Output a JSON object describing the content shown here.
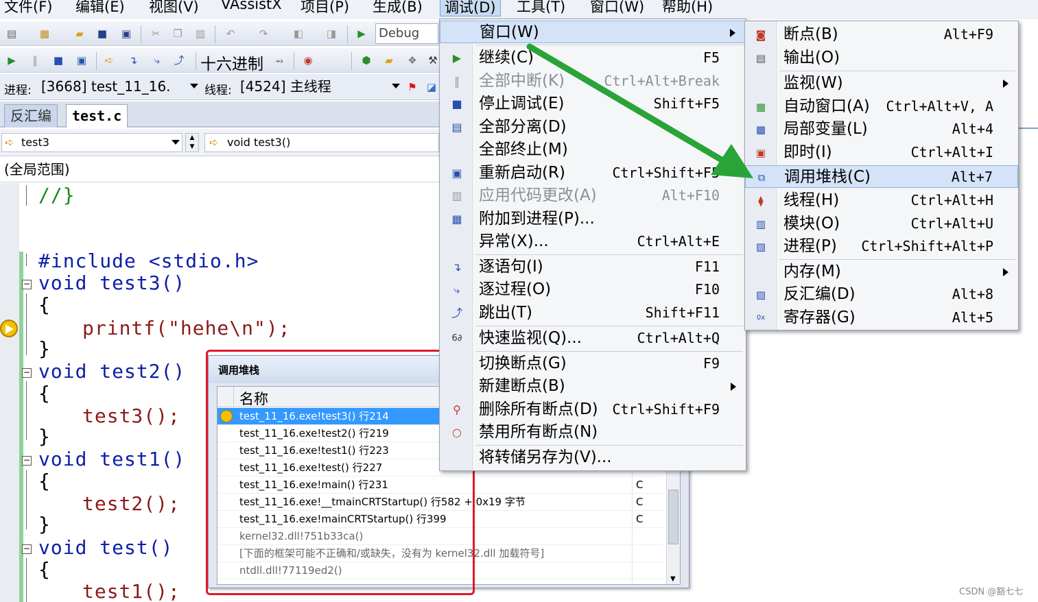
{
  "menubar": {
    "items": [
      "文件(F)",
      "编辑(E)",
      "视图(V)",
      "VAssistX",
      "项目(P)",
      "生成(B)",
      "调试(D)",
      "工具(T)",
      "窗口(W)",
      "帮助(H)"
    ]
  },
  "toolbar": {
    "config": "Debug",
    "hex_label": "十六进制"
  },
  "process_bar": {
    "process_label": "进程:",
    "process_value": "[3668] test_11_16.",
    "thread_label": "线程:",
    "thread_value": "[4524] 主线程"
  },
  "tabs": [
    "反汇编",
    "test.c"
  ],
  "nav": {
    "left": "test3",
    "right": "void test3()"
  },
  "scope": "(全局范围)",
  "code": [
    "//}",
    "#include <stdio.h>",
    "void test3()",
    "{",
    "printf(\"hehe\\n\");",
    "}",
    "void test2()",
    "{",
    "test3();",
    "}",
    "void test1()",
    "{",
    "test2();",
    "}",
    "void test()",
    "{",
    "test1();"
  ],
  "callstack": {
    "title": "调用堆栈",
    "column_name": "名称",
    "rows": [
      {
        "name": "test_11_16.exe!test3() 行214",
        "lang": ""
      },
      {
        "name": "test_11_16.exe!test2() 行219",
        "lang": ""
      },
      {
        "name": "test_11_16.exe!test1() 行223",
        "lang": ""
      },
      {
        "name": "test_11_16.exe!test() 行227",
        "lang": ""
      },
      {
        "name": "test_11_16.exe!main() 行231",
        "lang": "C"
      },
      {
        "name": "test_11_16.exe!__tmainCRTStartup() 行582 + 0x19 字节",
        "lang": "C"
      },
      {
        "name": "test_11_16.exe!mainCRTStartup() 行399",
        "lang": "C"
      },
      {
        "name": "kernel32.dll!751b33ca()",
        "lang": ""
      },
      {
        "name": "[下面的框架可能不正确和/或缺失，没有为 kernel32.dll 加载符号]",
        "lang": ""
      },
      {
        "name": "ntdll.dll!77119ed2()",
        "lang": ""
      }
    ]
  },
  "debug_menu": {
    "items": [
      {
        "label": "窗口(W)",
        "shortcut": "",
        "submenu": true,
        "disabled": false
      },
      {
        "label": "继续(C)",
        "shortcut": "F5",
        "disabled": false
      },
      {
        "label": "全部中断(K)",
        "shortcut": "Ctrl+Alt+Break",
        "disabled": true
      },
      {
        "label": "停止调试(E)",
        "shortcut": "Shift+F5",
        "disabled": false
      },
      {
        "label": "全部分离(D)",
        "shortcut": "",
        "disabled": false
      },
      {
        "label": "全部终止(M)",
        "shortcut": "",
        "disabled": false
      },
      {
        "label": "重新启动(R)",
        "shortcut": "Ctrl+Shift+F5",
        "disabled": false
      },
      {
        "label": "应用代码更改(A)",
        "shortcut": "Alt+F10",
        "disabled": true
      },
      {
        "label": "附加到进程(P)...",
        "shortcut": "",
        "disabled": false
      },
      {
        "label": "异常(X)...",
        "shortcut": "Ctrl+Alt+E",
        "disabled": false
      },
      {
        "label": "逐语句(I)",
        "shortcut": "F11",
        "disabled": false
      },
      {
        "label": "逐过程(O)",
        "shortcut": "F10",
        "disabled": false
      },
      {
        "label": "跳出(T)",
        "shortcut": "Shift+F11",
        "disabled": false
      },
      {
        "label": "快速监视(Q)...",
        "shortcut": "Ctrl+Alt+Q",
        "disabled": false
      },
      {
        "label": "切换断点(G)",
        "shortcut": "F9",
        "disabled": false
      },
      {
        "label": "新建断点(B)",
        "shortcut": "",
        "submenu": true,
        "disabled": false
      },
      {
        "label": "删除所有断点(D)",
        "shortcut": "Ctrl+Shift+F9",
        "disabled": false
      },
      {
        "label": "禁用所有断点(N)",
        "shortcut": "",
        "disabled": false
      },
      {
        "label": "将转储另存为(V)...",
        "shortcut": "",
        "disabled": false
      }
    ]
  },
  "window_menu": {
    "items": [
      {
        "label": "断点(B)",
        "shortcut": "Alt+F9"
      },
      {
        "label": "输出(O)",
        "shortcut": ""
      },
      {
        "label": "监视(W)",
        "shortcut": "",
        "submenu": true
      },
      {
        "label": "自动窗口(A)",
        "shortcut": "Ctrl+Alt+V, A"
      },
      {
        "label": "局部变量(L)",
        "shortcut": "Alt+4"
      },
      {
        "label": "即时(I)",
        "shortcut": "Ctrl+Alt+I"
      },
      {
        "label": "调用堆栈(C)",
        "shortcut": "Alt+7",
        "highlighted": true
      },
      {
        "label": "线程(H)",
        "shortcut": "Ctrl+Alt+H"
      },
      {
        "label": "模块(O)",
        "shortcut": "Ctrl+Alt+U"
      },
      {
        "label": "进程(P)",
        "shortcut": "Ctrl+Shift+Alt+P"
      },
      {
        "label": "内存(M)",
        "shortcut": "",
        "submenu": true
      },
      {
        "label": "反汇编(D)",
        "shortcut": "Alt+8"
      },
      {
        "label": "寄存器(G)",
        "shortcut": "Alt+5"
      }
    ]
  },
  "watermark": "CSDN @豁七七",
  "colors": {
    "annotation_arrow": "#2aa338",
    "annotation_rect": "#e0162b",
    "selection": "#3399ff",
    "menu_highlight": "#d4e3f8"
  }
}
